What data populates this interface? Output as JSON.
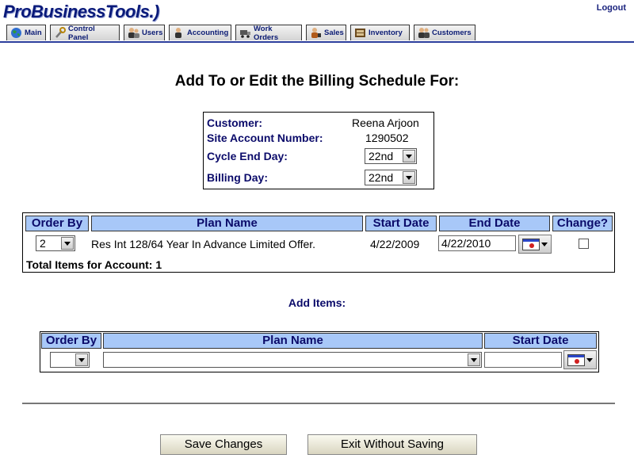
{
  "app": {
    "logo_text": "ProBusinessTools.)",
    "logout_label": "Logout"
  },
  "tabs": [
    {
      "label": "Main",
      "icon": "globe-icon"
    },
    {
      "label": "Control Panel",
      "icon": "wrench-icon"
    },
    {
      "label": "Users",
      "icon": "users-icon"
    },
    {
      "label": "Accounting",
      "icon": "accountant-icon"
    },
    {
      "label": "Work Orders",
      "icon": "truck-icon"
    },
    {
      "label": "Sales",
      "icon": "sales-icon"
    },
    {
      "label": "Inventory",
      "icon": "inventory-icon"
    },
    {
      "label": "Customers",
      "icon": "customers-icon"
    }
  ],
  "page_title": "Add To or Edit the Billing Schedule For:",
  "info": {
    "customer_label": "Customer:",
    "customer_value": "Reena Arjoon",
    "site_account_label": "Site Account Number:",
    "site_account_value": "1290502",
    "cycle_end_label": "Cycle End Day:",
    "cycle_end_value": "22nd",
    "billing_day_label": "Billing Day:",
    "billing_day_value": "22nd"
  },
  "schedule": {
    "headers": {
      "order_by": "Order By",
      "plan_name": "Plan Name",
      "start_date": "Start Date",
      "end_date": "End Date",
      "change": "Change?"
    },
    "rows": [
      {
        "order": "2",
        "plan": "Res Int 128/64 Year In Advance Limited Offer.",
        "start": "4/22/2009",
        "end": "4/22/2010",
        "changed": false
      }
    ],
    "total_text": "Total Items for Account: 1"
  },
  "add_items": {
    "title": "Add Items:",
    "headers": {
      "order_by": "Order By",
      "plan_name": "Plan Name",
      "start_date": "Start Date"
    },
    "order_value": "",
    "plan_value": "",
    "start_value": ""
  },
  "buttons": {
    "save": "Save Changes",
    "exit": "Exit Without Saving"
  },
  "colors": {
    "header_bg": "#a8c8f8",
    "label_text": "#0b0b6a",
    "nav_line": "#2c3e9c"
  }
}
